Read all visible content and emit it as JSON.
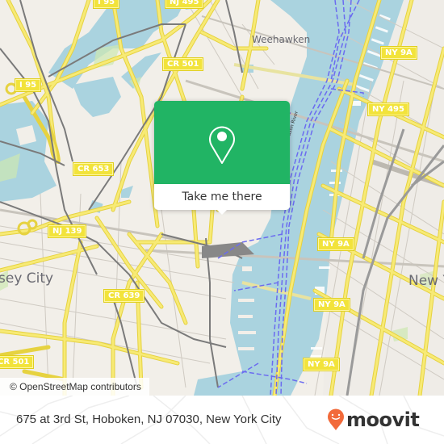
{
  "map": {
    "attribution": "© OpenStreetMap contributors",
    "colors": {
      "land": "#f2efe9",
      "water": "#aad3df",
      "road": "#f7e35c",
      "road_casing": "#e6d240",
      "rail": "#777777",
      "ferry": "#6b6bf0",
      "park": "#cde8b0",
      "minor_road": "#c9c5bd"
    },
    "place_labels": [
      {
        "text": "Weehawken"
      },
      {
        "text": "sey City"
      },
      {
        "text": "New Y"
      }
    ],
    "water_labels": [
      {
        "text": "Hudson River"
      }
    ],
    "shields": [
      {
        "text": "I 95"
      },
      {
        "text": "NJ 495"
      },
      {
        "text": "I 95"
      },
      {
        "text": "CR 501"
      },
      {
        "text": "CR 653"
      },
      {
        "text": "NJ 139"
      },
      {
        "text": "CR 639"
      },
      {
        "text": "CR 501"
      },
      {
        "text": "NY 9A"
      },
      {
        "text": "NY 495"
      },
      {
        "text": "NY 9A"
      },
      {
        "text": "NY 9A"
      },
      {
        "text": "NY 9A"
      }
    ]
  },
  "popup": {
    "icon": "location-pin-icon",
    "button_label": "Take me there",
    "color": "#21b464"
  },
  "footer": {
    "address": "675 at 3rd St, Hoboken, NJ 07030, New York City",
    "brand": {
      "name": "moovit",
      "icon": "moovit-pin-smile-icon",
      "color": "#f26a3a"
    }
  }
}
